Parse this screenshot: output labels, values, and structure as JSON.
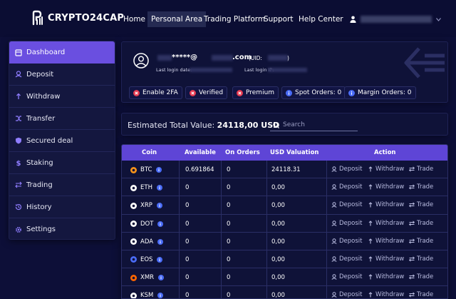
{
  "logo": {
    "text": "CRYPTO24CAP"
  },
  "nav": {
    "items": [
      {
        "label": "Home",
        "active": false
      },
      {
        "label": "Personal Area",
        "active": true
      },
      {
        "label": "Trading Platform",
        "active": false
      },
      {
        "label": "Support",
        "active": false
      },
      {
        "label": "Help Center",
        "active": false
      }
    ]
  },
  "sidebar": {
    "items": [
      {
        "label": "Dashboard",
        "icon": "dashboard-icon",
        "active": true
      },
      {
        "label": "Deposit",
        "icon": "deposit-icon"
      },
      {
        "label": "Withdraw",
        "icon": "withdraw-icon"
      },
      {
        "label": "Transfer",
        "icon": "transfer-icon"
      },
      {
        "label": "Secured deal",
        "icon": "shield-icon"
      },
      {
        "label": "Staking",
        "icon": "dollar-icon"
      },
      {
        "label": "Trading",
        "icon": "swap-icon"
      },
      {
        "label": "History",
        "icon": "history-icon"
      },
      {
        "label": "Settings",
        "icon": "gear-icon"
      }
    ]
  },
  "user": {
    "email_prefix": "*****@",
    "email_suffix": ".com",
    "uid_label": "(UID:",
    "uid_close": ")",
    "last_login_date_label": "Last login date:",
    "last_login_ip_label": "Last login IP:"
  },
  "badges": [
    {
      "label": "Enable 2FA",
      "icon": "x-circle-icon"
    },
    {
      "label": "Verified",
      "icon": "x-circle-icon"
    },
    {
      "label": "Premium",
      "icon": "x-circle-icon"
    },
    {
      "label": "Spot Orders: 0",
      "icon": "info-circle-icon"
    },
    {
      "label": "Margin Orders: 0",
      "icon": "info-circle-icon"
    }
  ],
  "summary": {
    "label": "Estimated Total Value:",
    "amount": "24118,00 USD"
  },
  "search": {
    "placeholder": "Search"
  },
  "table": {
    "headers": {
      "coin": "Coin",
      "available": "Available",
      "orders": "On Orders",
      "usd": "USD Valuation",
      "action": "Action"
    },
    "actions": {
      "deposit": "Deposit",
      "withdraw": "Withdraw",
      "trade": "Trade"
    },
    "rows": [
      {
        "coin": "BTC",
        "available": "0.691864",
        "orders": "0",
        "usd": "24118.31",
        "icon_color": "#f7931a"
      },
      {
        "coin": "ETH",
        "available": "0",
        "orders": "0",
        "usd": "0,00",
        "icon_color": "#ffffff"
      },
      {
        "coin": "XRP",
        "available": "0",
        "orders": "0",
        "usd": "0,00",
        "icon_color": "#ffffff"
      },
      {
        "coin": "DOT",
        "available": "0",
        "orders": "0",
        "usd": "0,00",
        "icon_color": "#ffffff"
      },
      {
        "coin": "ADA",
        "available": "0",
        "orders": "0",
        "usd": "0,00",
        "icon_color": "#ffffff"
      },
      {
        "coin": "EOS",
        "available": "0",
        "orders": "0",
        "usd": "0,00",
        "icon_color": "#4a6cf7"
      },
      {
        "coin": "XMR",
        "available": "0",
        "orders": "0",
        "usd": "0,00",
        "icon_color": "#ff6600"
      },
      {
        "coin": "KSM",
        "available": "0",
        "orders": "0",
        "usd": "0,00",
        "icon_color": "#ffffff"
      }
    ]
  },
  "colors": {
    "background": "#0d0f38",
    "accent": "#6a4fe0",
    "table_header": "#5e45d6",
    "danger": "#e53950",
    "info": "#4a6cf7"
  }
}
